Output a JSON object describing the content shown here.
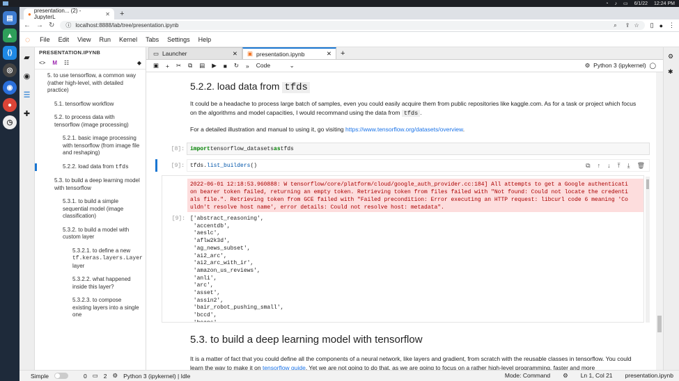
{
  "sys": {
    "activities": "Activities",
    "date": "6/1/22",
    "time": "12:24 PM"
  },
  "browser": {
    "tab_title": "presentation... (2) - JupyterL",
    "url": "localhost:8888/lab/tree/presentation.ipynb"
  },
  "menu": [
    "File",
    "Edit",
    "View",
    "Run",
    "Kernel",
    "Tabs",
    "Settings",
    "Help"
  ],
  "sidebar": {
    "title": "PRESENTATION.IPYNB",
    "toc": [
      {
        "text": "5. to use tensorflow, a common way (rather high-level, with detailed practice)",
        "level": 0
      },
      {
        "text": "5.1. tensorflow workflow",
        "level": 1
      },
      {
        "text": "5.2. to process data with tensorflow (image processing)",
        "level": 1
      },
      {
        "text": "5.2.1. basic image processing with tensorflow (from image file and reshaping)",
        "level": 2
      },
      {
        "text": "5.2.2. load data from",
        "code": "tfds",
        "level": 2,
        "active": true
      },
      {
        "text": "5.3. to build a deep learning model with tensorflow",
        "level": 1
      },
      {
        "text": "5.3.1. to build a simple sequential model (image classification)",
        "level": 2
      },
      {
        "text": "5.3.2. to build a model with custom layer",
        "level": 2
      },
      {
        "text": "5.3.2.1. to define a new",
        "code": "tf.keras.layers.Layer",
        "after": "layer",
        "level": 3
      },
      {
        "text": "5.3.2.2. what happened inside this layer?",
        "level": 3
      },
      {
        "text": "5.3.2.3. to compose existing layers into a single one",
        "level": 3
      }
    ]
  },
  "doc_tabs": [
    "Launcher",
    "presentation.ipynb"
  ],
  "toolbar": {
    "cell_type": "Code",
    "kernel": "Python 3 (ipykernel)"
  },
  "notebook": {
    "h3_text": "5.2.2. load data from ",
    "h3_code": "tfds",
    "p1a": "It could be a headache to process large batch of samples, even you could easily acquire them from public repositories like kaggle.com. As for a task or project which focus on the algorithms and model capacities, I would recommand using the data from ",
    "p1code": "tfds",
    "p1b": ".",
    "p2a": "For a detailed illustration and manual to using it, go visiting ",
    "p2link": "https://www.tensorflow.org/datasets/overview",
    "p2b": ".",
    "c8_prompt": "[8]:",
    "c8_kw1": "import",
    "c8_mod": " tensorflow_datasets ",
    "c8_kw2": "as",
    "c8_alias": " tfds",
    "c9_prompt": "[9]:",
    "c9_obj": "tfds.",
    "c9_fn": "list_builders",
    "c9_tail": "()",
    "stderr": "2022-06-01 12:18:53.960888: W tensorflow/core/platform/cloud/google_auth_provider.cc:184] All attempts to get a Google authenticati\non bearer token failed, returning an empty token. Retrieving token from files failed with \"Not found: Could not locate the credenti\nals file.\". Retrieving token from GCE failed with \"Failed precondition: Error executing an HTTP request: libcurl code 6 meaning 'Co\nuldn't resolve host name', error details: Could not resolve host: metadata\".",
    "out_prompt": "[9]:",
    "output": "['abstract_reasoning',\n 'accentdb',\n 'aeslc',\n 'aflw2k3d',\n 'ag_news_subset',\n 'ai2_arc',\n 'ai2_arc_with_ir',\n 'amazon_us_reviews',\n 'anli',\n 'arc',\n 'asset',\n 'assin2',\n 'bair_robot_pushing_small',\n 'bccd',\n 'beans',",
    "h2": "5.3. to build a deep learning model with tensorflow",
    "p3a": "It is a matter of fact that you could define all the components of a neural network, like layers and gradient, from scratch with the reusable classes in tensorflow. You could learn the way to make it on ",
    "p3link": "tensorflow guide",
    "p3b": ". Yet we are not going to do that, as we are going to focus on a rather high-level programming, faster and more"
  },
  "status": {
    "mode_label": "Simple",
    "n1": "0",
    "n2": "2",
    "kernel_state": "Python 3 (ipykernel) | Idle",
    "mode": "Mode: Command",
    "pos": "Ln 1, Col 21",
    "file": "presentation.ipynb"
  }
}
